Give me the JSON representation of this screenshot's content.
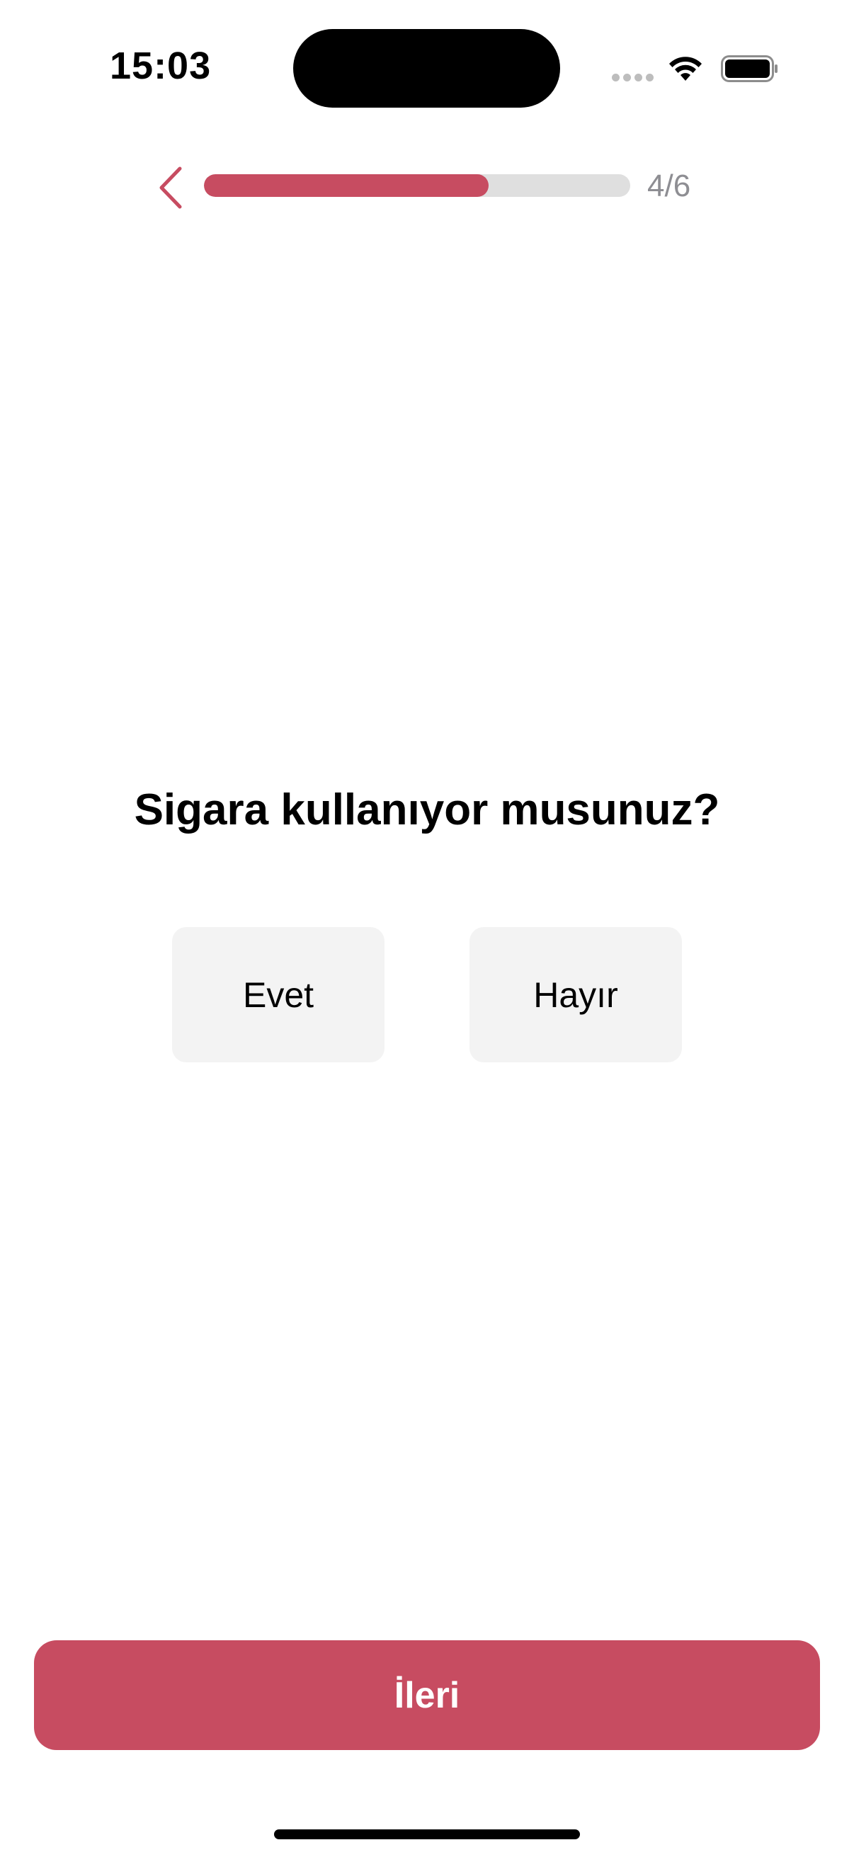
{
  "status_bar": {
    "time": "15:03",
    "icons": [
      "signal-dots-icon",
      "wifi-icon",
      "battery-icon"
    ]
  },
  "header": {
    "back_icon": "chevron-left-icon",
    "progress": {
      "current": 4,
      "total": 6,
      "fraction": 0.667
    },
    "step_label": "4/6"
  },
  "question": {
    "title": "Sigara kullanıyor musunuz?",
    "options": [
      {
        "label": "Evet"
      },
      {
        "label": "Hayır"
      }
    ]
  },
  "footer": {
    "next_label": "İleri"
  },
  "colors": {
    "accent": "#c74c61",
    "track": "#dfdfdf",
    "option_bg": "#f3f3f3",
    "muted_text": "#8e8e93"
  }
}
